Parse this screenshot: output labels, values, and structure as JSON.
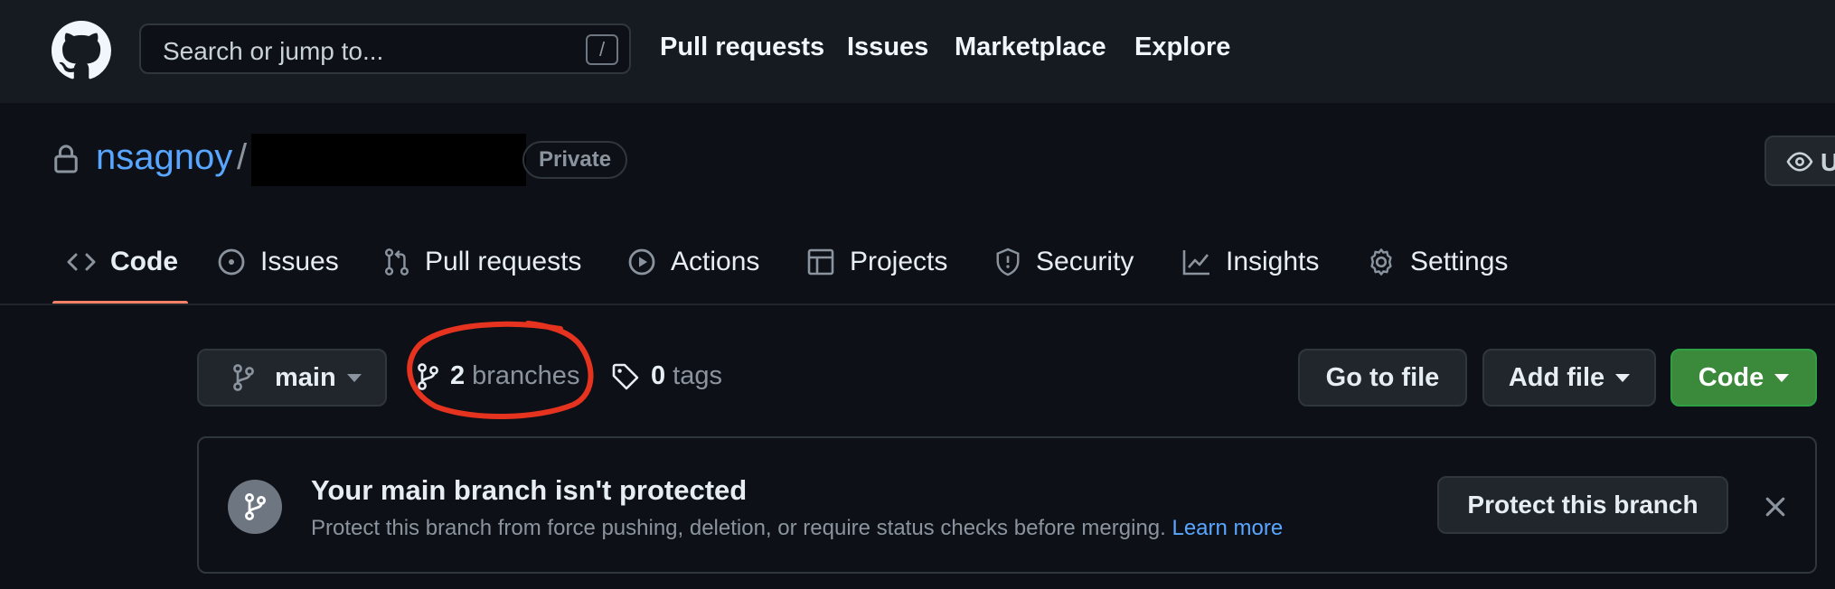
{
  "header": {
    "search_placeholder": "Search or jump to...",
    "search_shortcut": "/",
    "nav": [
      {
        "label": "Pull requests"
      },
      {
        "label": "Issues"
      },
      {
        "label": "Marketplace"
      },
      {
        "label": "Explore"
      }
    ]
  },
  "repo": {
    "owner": "nsagnoy",
    "separator": "/",
    "visibility": "Private",
    "watch_label": "U"
  },
  "tabs": [
    {
      "label": "Code",
      "icon": "code-icon",
      "active": true
    },
    {
      "label": "Issues",
      "icon": "issue-opened-icon"
    },
    {
      "label": "Pull requests",
      "icon": "git-pull-request-icon"
    },
    {
      "label": "Actions",
      "icon": "play-icon"
    },
    {
      "label": "Projects",
      "icon": "table-icon"
    },
    {
      "label": "Security",
      "icon": "shield-icon"
    },
    {
      "label": "Insights",
      "icon": "graph-icon"
    },
    {
      "label": "Settings",
      "icon": "gear-icon"
    }
  ],
  "toolbar": {
    "branch": "main",
    "branches_count": "2",
    "branches_label": "branches",
    "tags_count": "0",
    "tags_label": "tags",
    "goto_file": "Go to file",
    "add_file": "Add file",
    "code": "Code"
  },
  "banner": {
    "title": "Your main branch isn't protected",
    "description": "Protect this branch from force pushing, deletion, or require status checks before merging.",
    "link": "Learn more",
    "button": "Protect this branch"
  },
  "colors": {
    "background": "#0d1117",
    "header": "#161b22",
    "link": "#58a6ff",
    "active_tab_underline": "#f78166",
    "code_button": "#3b8a3b",
    "annotation": "#e5331f"
  }
}
